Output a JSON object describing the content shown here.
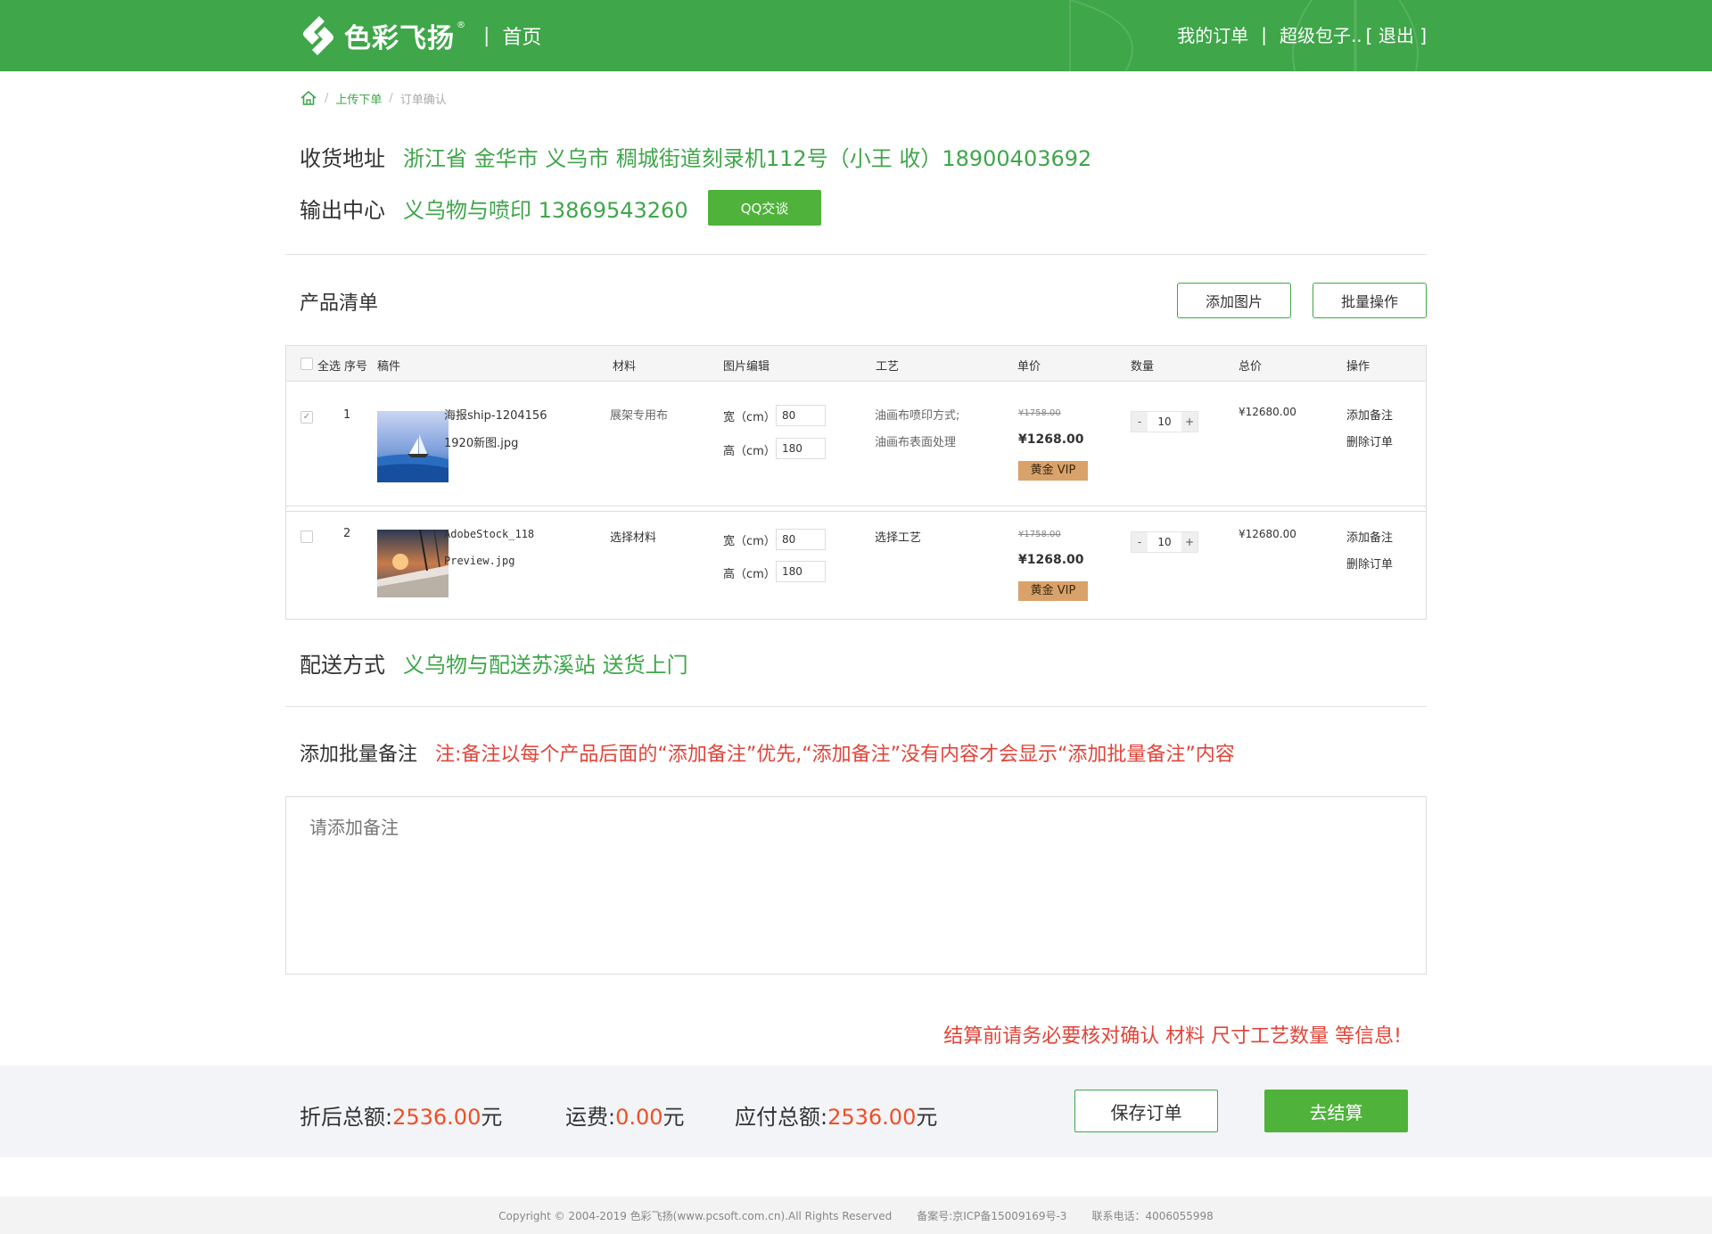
{
  "header": {
    "brand": "色彩飞扬",
    "brand_reg": "®",
    "separator": "|",
    "home": "首页",
    "my_orders": "我的订单",
    "pipe": "|",
    "user": "超级包子..",
    "logout": "[ 退出 ]",
    "bg_color": "#3fa64a"
  },
  "breadcrumb": {
    "sep": "/",
    "upload": "上传下单",
    "current": "订单确认"
  },
  "address": {
    "label": "收货地址",
    "value": "浙江省 金华市 义乌市 稠城街道刻录机112号（小王 收）18900403692"
  },
  "output_center": {
    "label": "输出中心",
    "value": "义乌物与喷印  13869543260",
    "qq_button": "QQ交谈"
  },
  "products": {
    "title": "产品清单",
    "add_image": "添加图片",
    "batch": "批量操作",
    "columns": {
      "select_all": "全选",
      "index": "序号",
      "file": "稿件",
      "material": "材料",
      "image_edit": "图片编辑",
      "craft": "工艺",
      "unit_price": "单价",
      "qty": "数量",
      "total": "总价",
      "ops": "操作"
    },
    "rows": [
      {
        "checked": "✓",
        "index": "1",
        "file_line1": "海报ship-1204156",
        "file_line2": "1920新图.jpg",
        "material": "展架专用布",
        "width_label": "宽（cm）",
        "width": "80",
        "height_label": "高（cm）",
        "height": "180",
        "craft_line1": "油画布喷印方式;",
        "craft_line2": "油画布表面处理",
        "old_price": "¥1758.00",
        "price": "¥1268.00",
        "vip": "黄金 VIP",
        "minus": "-",
        "qty": "10",
        "plus": "+",
        "total": "¥12680.00",
        "add_note": "添加备注",
        "delete": "删除订单"
      },
      {
        "checked": "",
        "index": "2",
        "file_line1": "AdobeStock_118",
        "file_line2": "Preview.jpg",
        "material": "选择材料",
        "width_label": "宽（cm）",
        "width": "80",
        "height_label": "高（cm）",
        "height": "180",
        "craft_line1": "选择工艺",
        "craft_line2": "",
        "old_price": "¥1758.00",
        "price": "¥1268.00",
        "vip": "黄金 VIP",
        "minus": "-",
        "qty": "10",
        "plus": "+",
        "total": "¥12680.00",
        "add_note": "添加备注",
        "delete": "删除订单"
      }
    ]
  },
  "shipping": {
    "label": "配送方式",
    "value": "义乌物与配送苏溪站  送货上门"
  },
  "notes": {
    "label": "添加批量备注",
    "tip": "注:备注以每个产品后面的“添加备注”优先,“添加备注”没有内容才会显示“添加批量备注”内容",
    "placeholder": "请添加备注"
  },
  "warning": "结算前请务必要核对确认 材料 尺寸工艺数量 等信息!",
  "summary": {
    "discount_label": "折后总额:",
    "discount_value": "2536.00",
    "unit": "元",
    "freight_label": "运费:",
    "freight_value": "0.00",
    "payable_label": "应付总额:",
    "payable_value": "2536.00",
    "save": "保存订单",
    "checkout": "去结算"
  },
  "footer": {
    "copyright": "Copyright © 2004-2019 色彩飞扬(www.pcsoft.com.cn).All Rights Reserved",
    "icp": "备案号:京ICP备15009169号-3",
    "phone": "联系电话：4006055998"
  }
}
